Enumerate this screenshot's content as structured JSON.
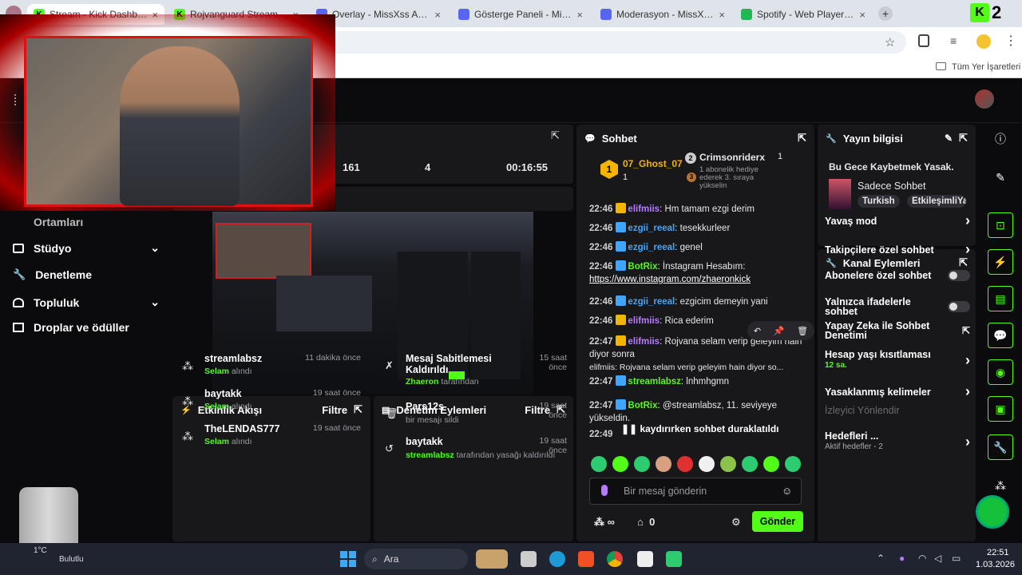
{
  "browser": {
    "tabs": [
      {
        "title": "Stream - Kick Dashboard",
        "active": true,
        "favicon_color": "#53fc18",
        "favicon_text": "K"
      },
      {
        "title": "Rojvanguard Stream - Watch",
        "active": false,
        "favicon_color": "#53fc18",
        "favicon_text": "K"
      },
      {
        "title": "Overlay - MissXss AI Bot S",
        "active": false,
        "favicon_color": "#5865f2",
        "favicon_text": ""
      },
      {
        "title": "Gösterge Paneli - MissXss",
        "active": false,
        "favicon_color": "#5865f2",
        "favicon_text": ""
      },
      {
        "title": "Moderasyon - MissXss Yap",
        "active": false,
        "favicon_color": "#5865f2",
        "favicon_text": ""
      },
      {
        "title": "Spotify - Web Player: Herk",
        "active": false,
        "favicon_color": "#1db954",
        "favicon_text": ""
      }
    ],
    "new_tab_label": "+",
    "bookmarks_all_label": "Tüm Yer İşaretleri",
    "extension_badge": "2"
  },
  "sidebar": {
    "partial_item": "Ortamları",
    "items": [
      {
        "label": "Stüdyo",
        "icon": "studio-icon",
        "chevron": true
      },
      {
        "label": "Denetleme",
        "icon": "wrench-icon",
        "chevron": false
      },
      {
        "label": "Topluluk",
        "icon": "people-icon",
        "chevron": true
      },
      {
        "label": "Droplar ve ödüller",
        "icon": "gift-icon",
        "chevron": false
      }
    ]
  },
  "stats": {
    "followers": "161",
    "viewers": "4",
    "uptime": "00:16:55"
  },
  "chat": {
    "title": "Sohbet",
    "top_gifters": [
      {
        "name": "07_Ghost_07",
        "rank": "1",
        "count": "1"
      },
      {
        "name": "Crimsonriderx",
        "rank": "2",
        "count": "1"
      }
    ],
    "rank_note": "1 abonelik hediye ederek 3. sıraya yükselin",
    "rank_note_num": "3",
    "messages": [
      {
        "time": "22:46",
        "user": "elifmiis",
        "text": "Hm tamam ezgi derim",
        "color": "u1"
      },
      {
        "time": "22:46",
        "user": "ezgii_reeal",
        "text": "tesekkurleer",
        "color": "u2"
      },
      {
        "time": "22:46",
        "user": "ezgii_reeal",
        "text": "genel",
        "color": "u2"
      },
      {
        "time": "22:46",
        "user": "BotRix",
        "text": "İnstagram Hesabım:",
        "link": "https://www.instagram.com/zhaeronkick",
        "color": "u3"
      },
      {
        "time": "22:46",
        "user": "ezgii_reeal",
        "text": "ezgicim demeyin yani",
        "color": "u2"
      },
      {
        "time": "22:46",
        "user": "elifmiis",
        "text": "Rica ederim",
        "color": "u1"
      },
      {
        "time": "22:47",
        "user": "elifmiis",
        "text": "Rojvana selam verip geleyim hain diyor sonra",
        "color": "u1"
      },
      {
        "time": "22:47",
        "user": "streamlabsz",
        "text": "lnhmhgmn",
        "color": "u3",
        "reply": "elifmiis: Rojvana selam verip geleyim hain diyor so..."
      },
      {
        "time": "22:47",
        "user": "BotRix",
        "text": "@streamlabsz, 11. seviyeye yükseldin.",
        "color": "u3"
      },
      {
        "time": "22:49",
        "user": "",
        "text": "",
        "color": "u3"
      }
    ],
    "paused_notice": "kaydırırken sohbet duraklatıldı",
    "input_placeholder": "Bir mesaj gönderin",
    "points_label": "∞",
    "gift_count": "0",
    "send_label": "Gönder"
  },
  "stream_info": {
    "title": "Yayın bilgisi",
    "stream_title": "Bu Gece Kaybetmek Yasak.",
    "category": "Sadece Sohbet",
    "tags": [
      "Turkish",
      "EtkileşimliYa"
    ]
  },
  "channel_actions": {
    "title": "Kanal Eylemleri",
    "items": [
      {
        "label": "Yavaş mod",
        "control": "chevron"
      },
      {
        "label": "Takipçilere özel sohbet",
        "control": "chevron"
      },
      {
        "label": "Abonelere özel sohbet",
        "control": "toggle"
      },
      {
        "label": "Yalnızca ifadelerle sohbet",
        "control": "toggle"
      },
      {
        "label": "Yapay Zeka ile Sohbet Denetimi",
        "control": "external"
      },
      {
        "label": "Hesap yaşı kısıtlaması",
        "sub": "12 sa.",
        "control": "chevron"
      },
      {
        "label": "Yasaklanmış kelimeler",
        "control": "chevron"
      },
      {
        "label": "İzleyici Yönlendir",
        "control": "none",
        "disabled": true
      },
      {
        "label": "Hedefleri ...",
        "sub": "Aktif hedefler - 2",
        "control": "chevron"
      }
    ]
  },
  "activity_feed": {
    "title": "Etkinlik Akışı",
    "filter_label": "Filtre",
    "items": [
      {
        "name": "streamlabsz",
        "action": "Selam",
        "suffix": "alındı",
        "time": "11 dakika önce"
      },
      {
        "name": "baytakk",
        "action": "Selam",
        "suffix": "alındı",
        "time": "19 saat önce"
      },
      {
        "name": "TheLENDAS777",
        "action": "Selam",
        "suffix": "alındı",
        "time": "19 saat önce"
      }
    ]
  },
  "mod_actions": {
    "title": "Denetim Eylemleri",
    "filter_label": "Filtre",
    "items": [
      {
        "name": "Mesaj Sabitlemesi Kaldırıldı",
        "by": "Zhaeron",
        "suffix": "tarafından",
        "time": "15 saat önce",
        "icon": "unpin-icon"
      },
      {
        "name": "Pars12s",
        "by": "",
        "suffix": "bir mesajı sildi",
        "time": "19 saat önce",
        "icon": "trash-icon"
      },
      {
        "name": "baytakk",
        "by": "streamlabsz",
        "suffix": "tarafından yasağı kaldırıldı",
        "time": "19 saat önce",
        "icon": "undo-icon"
      }
    ]
  },
  "taskbar": {
    "search_label": "Ara",
    "time": "22:51",
    "date": "1.03.2026",
    "weather_temp": "1°C",
    "weather_label": "Bulutlu"
  }
}
